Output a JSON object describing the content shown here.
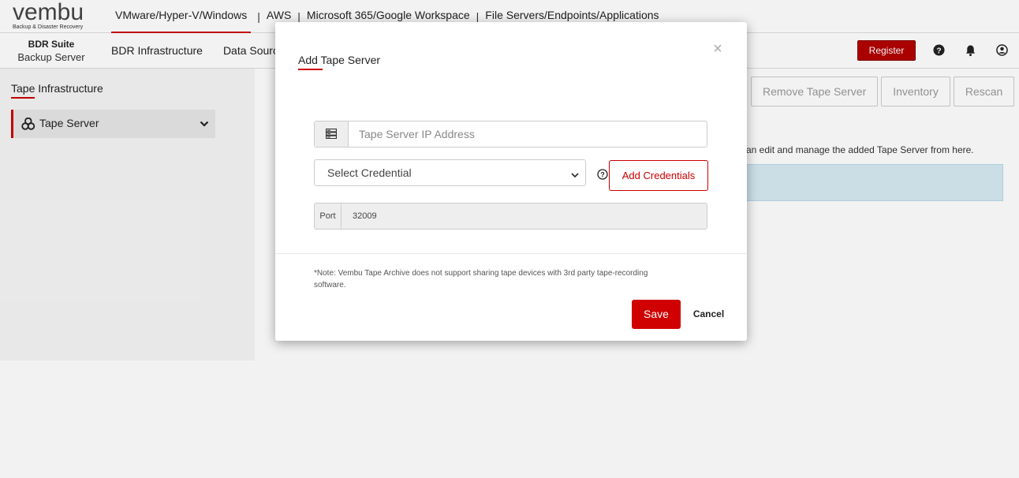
{
  "header": {
    "logo_text": "vembu",
    "logo_tagline": "Backup & Disaster Recovery",
    "platform_tabs": [
      "VMware/Hyper-V/Windows",
      "AWS",
      "Microsoft 365/Google Workspace",
      "File Servers/Endpoints/Applications"
    ],
    "separator": "|"
  },
  "subheader": {
    "suite_name": "BDR Suite",
    "suite_sub": "Backup Server",
    "nav": [
      "BDR Infrastructure",
      "Data Source"
    ],
    "register_label": "Register"
  },
  "sidebar": {
    "title": "Tape Infrastructure",
    "item_label": "Tape Server"
  },
  "background": {
    "action_buttons": [
      "Remove Tape Server",
      "Inventory",
      "Rescan"
    ],
    "info_text": "an edit and manage the added Tape Server from here."
  },
  "modal": {
    "title": "Add Tape Server",
    "close_symbol": "×",
    "ip_placeholder": "Tape Server IP Address",
    "credential_selected": "Select Credential",
    "add_credentials_label": "Add Credentials",
    "port_label": "Port",
    "port_value": "32009",
    "note": "*Note: Vembu Tape Archive does not support sharing tape devices with 3rd party tape-recording software.",
    "save_label": "Save",
    "cancel_label": "Cancel"
  },
  "colors": {
    "accent": "#cc0000",
    "register_bg": "#b30000",
    "banner_bg": "#d6e9f2"
  }
}
